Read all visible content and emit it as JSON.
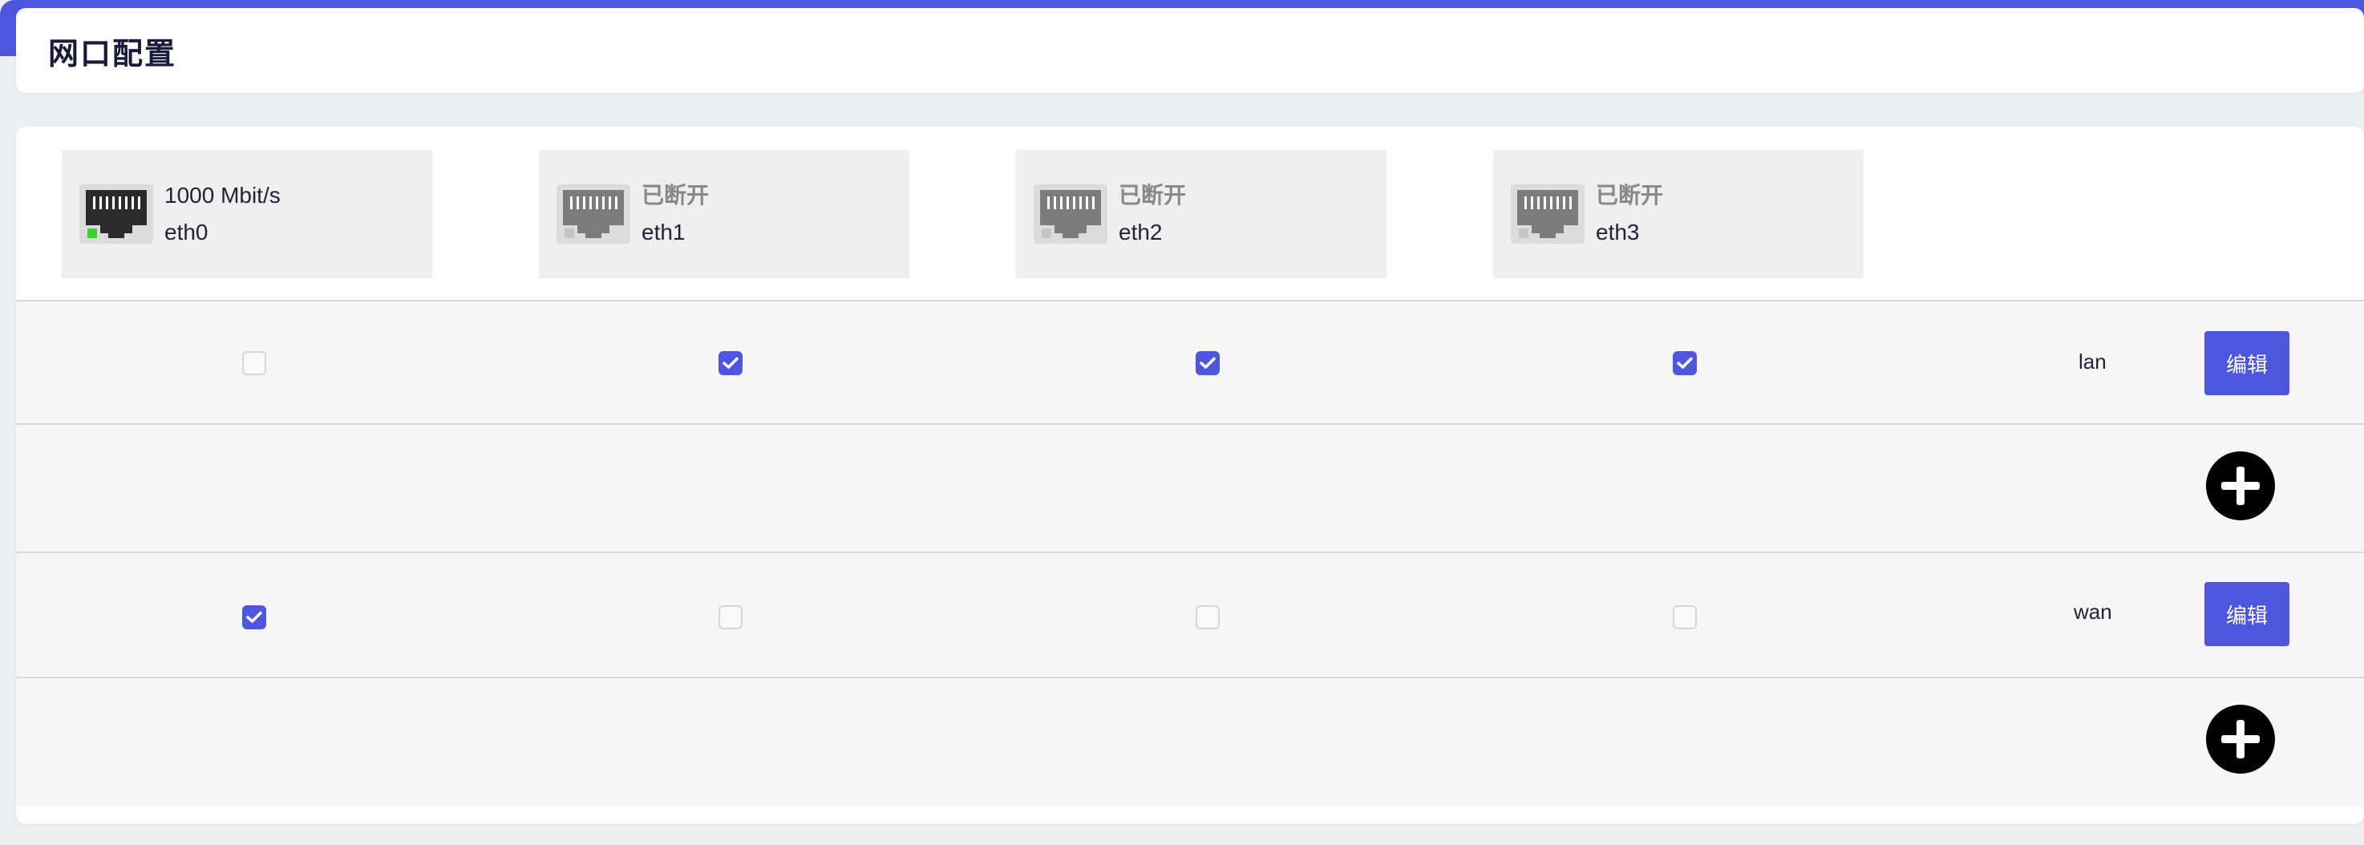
{
  "page": {
    "title": "网口配置"
  },
  "ports": [
    {
      "status": "1000 Mbit/s",
      "name": "eth0",
      "link": "up"
    },
    {
      "status": "已断开",
      "name": "eth1",
      "link": "down"
    },
    {
      "status": "已断开",
      "name": "eth2",
      "link": "down"
    },
    {
      "status": "已断开",
      "name": "eth3",
      "link": "down"
    }
  ],
  "interfaces": [
    {
      "name": "lan",
      "edit_label": "编辑",
      "members": [
        false,
        true,
        true,
        true
      ]
    },
    {
      "name": "wan",
      "edit_label": "编辑",
      "members": [
        true,
        false,
        false,
        false
      ]
    }
  ],
  "colors": {
    "accent": "#4f56de",
    "link_up": "#3ecf2e",
    "link_down": "#c4c4c4"
  },
  "icons": {
    "port": "ethernet-port-icon",
    "check": "check-icon",
    "add": "plus-icon"
  }
}
